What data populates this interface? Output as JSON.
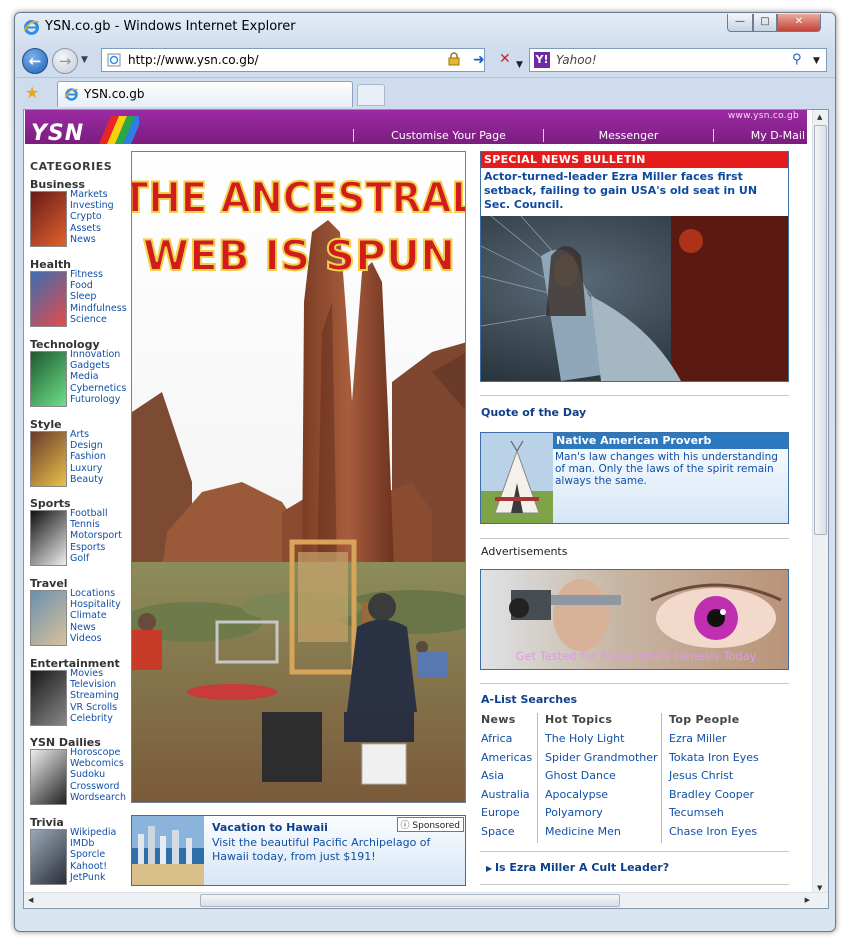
{
  "browser": {
    "title": "YSN.co.gb - Windows Internet Explorer",
    "url": "http://www.ysn.co.gb/",
    "search_placeholder": "Yahoo!",
    "tab_label": "YSN.co.gb"
  },
  "site": {
    "logo_text": "YSN",
    "domain": "www.ysn.co.gb",
    "nav": [
      "Customise Your Page",
      "Messenger",
      "My D-Mail"
    ]
  },
  "categories": {
    "title": "CATEGORIES",
    "groups": [
      {
        "name": "Business",
        "links": [
          "Markets",
          "Investing",
          "Crypto",
          "Assets",
          "News"
        ]
      },
      {
        "name": "Health",
        "links": [
          "Fitness",
          "Food",
          "Sleep",
          "Mindfulness",
          "Science"
        ]
      },
      {
        "name": "Technology",
        "links": [
          "Innovation",
          "Gadgets",
          "Media",
          "Cybernetics",
          "Futurology"
        ]
      },
      {
        "name": "Style",
        "links": [
          "Arts",
          "Design",
          "Fashion",
          "Luxury",
          "Beauty"
        ]
      },
      {
        "name": "Sports",
        "links": [
          "Football",
          "Tennis",
          "Motorsport",
          "Esports",
          "Golf"
        ]
      },
      {
        "name": "Travel",
        "links": [
          "Locations",
          "Hospitality",
          "Climate",
          "News",
          "Videos"
        ]
      },
      {
        "name": "Entertainment",
        "links": [
          "Movies",
          "Television",
          "Streaming",
          "VR Scrolls",
          "Celebrity"
        ]
      },
      {
        "name": "YSN Dailies",
        "links": [
          "Horoscope",
          "Webcomics",
          "Sudoku",
          "Crossword",
          "Wordsearch"
        ]
      },
      {
        "name": "Trivia",
        "links": [
          "Wikipedia",
          "IMDb",
          "Sporcle",
          "Kahoot!",
          "JetPunk"
        ]
      }
    ]
  },
  "hero": {
    "headline_line1": "THE ANCESTRAL",
    "headline_line2": "WEB IS SPUN"
  },
  "sponsored": {
    "title": "Vacation to Hawaii",
    "text": "Visit the beautiful Pacific Archipelago of Hawaii today, from just $191!",
    "badge": "Sponsored"
  },
  "bulletin": {
    "header": "SPECIAL NEWS BULLETIN",
    "text": "Actor-turned-leader Ezra Miller faces first setback, failing to gain USA's old seat in UN Sec. Council."
  },
  "quote": {
    "section_title": "Quote of the Day",
    "header": "Native American Proverb",
    "text": "Man's law changes with his understanding of man. Only the laws of the spirit remain always the same."
  },
  "ads": {
    "title": "Advertisements",
    "text": "Get Tested for Alexandria's Genesis Today"
  },
  "alist": {
    "title": "A-List Searches",
    "columns": [
      {
        "head": "News",
        "items": [
          "Africa",
          "Americas",
          "Asia",
          "Australia",
          "Europe",
          "Space"
        ]
      },
      {
        "head": "Hot Topics",
        "items": [
          "The Holy Light",
          "Spider Grandmother",
          "Ghost Dance",
          "Apocalypse",
          "Polyamory",
          "Medicine Men"
        ]
      },
      {
        "head": "Top People",
        "items": [
          "Ezra Miller",
          "Tokata Iron Eyes",
          "Jesus Christ",
          "Bradley Cooper",
          "Tecumseh",
          "Chase Iron Eyes"
        ]
      }
    ],
    "footer_link": "Is Ezra Miller A Cult Leader?"
  },
  "colors": {
    "banner": "#8a2290",
    "link": "#1150a6",
    "bulletin_red": "#e51c1c",
    "quote_blue": "#2d79c0"
  }
}
